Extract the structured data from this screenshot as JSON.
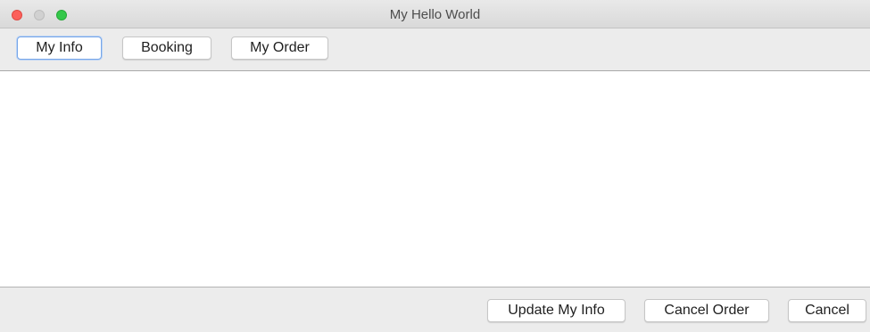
{
  "window": {
    "title": "My Hello World"
  },
  "toolbar": {
    "tabs": [
      {
        "label": "My Info",
        "active": true
      },
      {
        "label": "Booking",
        "active": false
      },
      {
        "label": "My Order",
        "active": false
      }
    ]
  },
  "footer": {
    "buttons": [
      {
        "label": "Update My Info"
      },
      {
        "label": "Cancel Order"
      },
      {
        "label": "Cancel"
      }
    ]
  },
  "colors": {
    "close": "#fc605b",
    "minimize": "#d1d1d1",
    "maximize": "#34c84a",
    "focus_ring": "#77a6e8"
  }
}
